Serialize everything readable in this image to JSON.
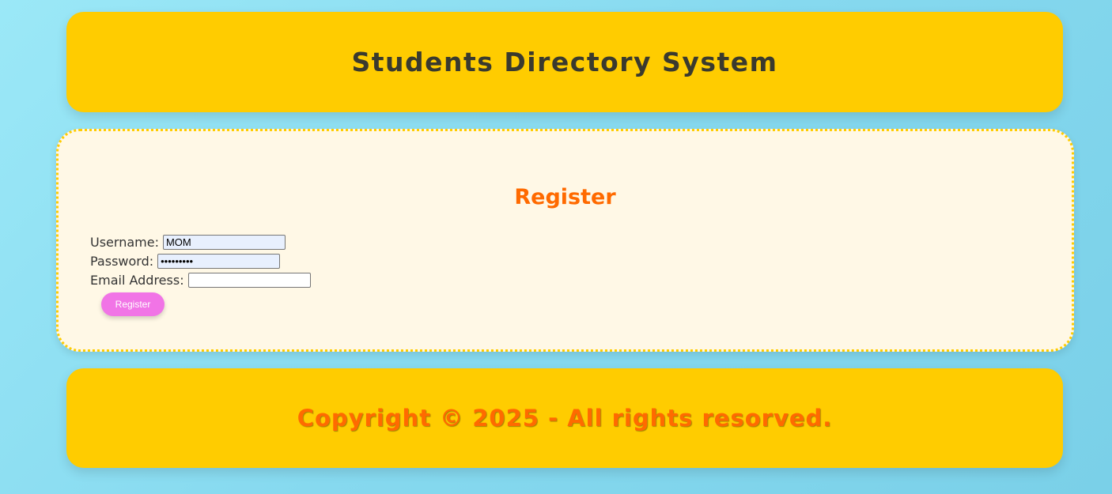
{
  "header": {
    "title": "Students Directory System"
  },
  "register": {
    "heading": "Register",
    "username_label": "Username:",
    "username_value": "MOM",
    "password_label": "Password:",
    "password_value": "•••••••••",
    "email_label": "Email Address:",
    "email_value": "",
    "button_label": "Register"
  },
  "footer": {
    "text": "Copyright © 2025 - All rights resorved."
  },
  "colors": {
    "header_bg": "#ffcc00",
    "accent_orange": "#ff6a00",
    "button_pink": "#f174e6",
    "panel_bg": "#fff8e6"
  }
}
